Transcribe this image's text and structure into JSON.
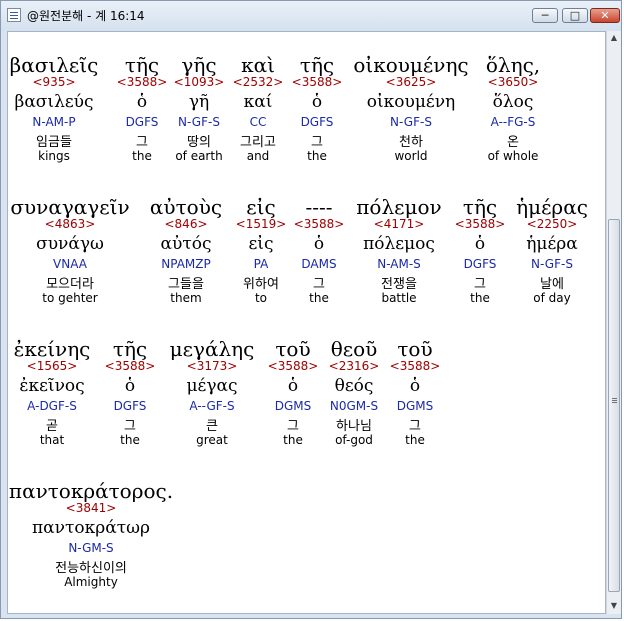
{
  "window": {
    "title": "@원전분해 - 계 16:14",
    "minimize_label": "─",
    "maximize_label": "□",
    "close_label": "✕"
  },
  "scrollbar": {
    "up": "▲",
    "down": "▼"
  },
  "rows": [
    {
      "words": [
        {
          "greek": "βασιλεῖς",
          "strong": "<935>",
          "lemma": "βασιλεύς",
          "morph": "N-AM-P",
          "korean": "임금들",
          "english": "kings"
        },
        {
          "greek": "τῆς",
          "strong": "<3588>",
          "lemma": "ὁ",
          "morph": "DGFS",
          "korean": "그",
          "english": "the"
        },
        {
          "greek": "γῆς",
          "strong": "<1093>",
          "lemma": "γῆ",
          "morph": "N-GF-S",
          "korean": "땅의",
          "english": "of earth"
        },
        {
          "greek": "καὶ",
          "strong": "<2532>",
          "lemma": "καί",
          "morph": "CC",
          "korean": "그리고",
          "english": "and"
        },
        {
          "greek": "τῆς",
          "strong": "<3588>",
          "lemma": "ὁ",
          "morph": "DGFS",
          "korean": "그",
          "english": "the"
        },
        {
          "greek": "οἰκουμένης",
          "strong": "<3625>",
          "lemma": "οἰκουμένη",
          "morph": "N-GF-S",
          "korean": "천하",
          "english": "world"
        },
        {
          "greek": "ὅλης,",
          "strong": "<3650>",
          "lemma": "ὅλος",
          "morph": "A--FG-S",
          "korean": "온",
          "english": "of whole"
        }
      ]
    },
    {
      "words": [
        {
          "greek": "συναγαγεῖν",
          "strong": "<4863>",
          "lemma": "συνάγω",
          "morph": "VNAA",
          "korean": "모으더라",
          "english": "to gehter"
        },
        {
          "greek": "αὐτοὺς",
          "strong": "<846>",
          "lemma": "αὐτός",
          "morph": "NPAMZP",
          "korean": "그들을",
          "english": "them"
        },
        {
          "greek": "εἰς",
          "strong": "<1519>",
          "lemma": "εἰς",
          "morph": "PA",
          "korean": "위하여",
          "english": "to"
        },
        {
          "greek": "----",
          "strong": "<3588>",
          "lemma": "ὁ",
          "morph": "DAMS",
          "korean": "그",
          "english": "the"
        },
        {
          "greek": "πόλεμον",
          "strong": "<4171>",
          "lemma": "πόλεμος",
          "morph": "N-AM-S",
          "korean": "전쟁을",
          "english": "battle"
        },
        {
          "greek": "τῆς",
          "strong": "<3588>",
          "lemma": "ὁ",
          "morph": "DGFS",
          "korean": "그",
          "english": "the"
        },
        {
          "greek": "ἡμέρας",
          "strong": "<2250>",
          "lemma": "ἡμέρα",
          "morph": "N-GF-S",
          "korean": "날에",
          "english": "of day"
        }
      ]
    },
    {
      "words": [
        {
          "greek": "ἐκείνης",
          "strong": "<1565>",
          "lemma": "ἐκεῖνος",
          "morph": "A-DGF-S",
          "korean": "곧",
          "english": "that"
        },
        {
          "greek": "τῆς",
          "strong": "<3588>",
          "lemma": "ὁ",
          "morph": "DGFS",
          "korean": "그",
          "english": "the"
        },
        {
          "greek": "μεγάλης",
          "strong": "<3173>",
          "lemma": "μέγας",
          "morph": "A--GF-S",
          "korean": "큰",
          "english": "great"
        },
        {
          "greek": "τοῦ",
          "strong": "<3588>",
          "lemma": "ὁ",
          "morph": "DGMS",
          "korean": "그",
          "english": "the"
        },
        {
          "greek": "θεοῦ",
          "strong": "<2316>",
          "lemma": "θεός",
          "morph": "N0GM-S",
          "korean": "하나님",
          "english": "of-god"
        },
        {
          "greek": "τοῦ",
          "strong": "<3588>",
          "lemma": "ὁ",
          "morph": "DGMS",
          "korean": "그",
          "english": "the"
        }
      ]
    },
    {
      "words": [
        {
          "greek": "παντοκράτορος.",
          "strong": "<3841>",
          "lemma": "παντοκράτωρ",
          "morph": "N-GM-S",
          "korean": "전능하신이의",
          "english": "Almighty"
        }
      ]
    }
  ]
}
